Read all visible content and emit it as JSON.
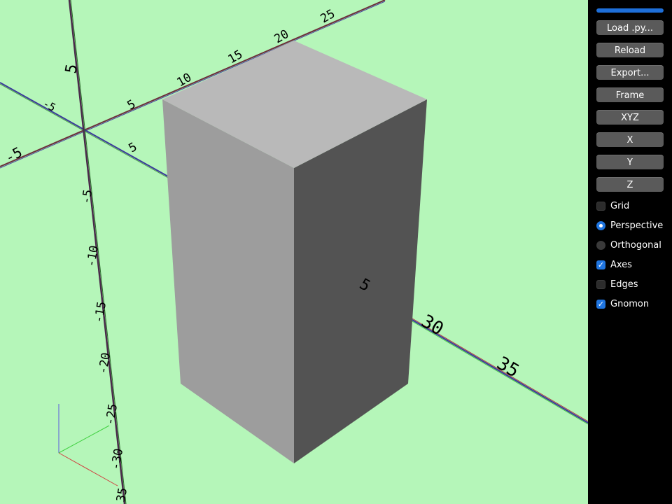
{
  "viewer": {
    "colors": {
      "background": "#b5f6b9",
      "box_top": "#b9b9b9",
      "box_front": "#9d9d9d",
      "box_side": "#535353"
    },
    "axis_labels": {
      "x_negative": "-5",
      "x_positive": [
        "5",
        "10",
        "15",
        "20",
        "25"
      ],
      "y_negative": "-5",
      "y_positive": [
        "5",
        "30",
        "35"
      ],
      "z_positive": "5",
      "z_negative": [
        "-5",
        "-10",
        "-15",
        "-20",
        "-25",
        "-30",
        "-35"
      ],
      "extra_label": "5"
    }
  },
  "panel": {
    "progress": 1.0,
    "buttons": {
      "load": "Load .py...",
      "reload": "Reload",
      "export": "Export...",
      "frame": "Frame",
      "xyz": "XYZ",
      "x": "X",
      "y": "Y",
      "z": "Z"
    },
    "options": {
      "grid": {
        "label": "Grid",
        "checked": false
      },
      "perspective": {
        "label": "Perspective",
        "selected": true
      },
      "orthogonal": {
        "label": "Orthogonal",
        "selected": false
      },
      "axes": {
        "label": "Axes",
        "checked": true
      },
      "edges": {
        "label": "Edges",
        "checked": false
      },
      "gnomon": {
        "label": "Gnomon",
        "checked": true
      }
    }
  }
}
